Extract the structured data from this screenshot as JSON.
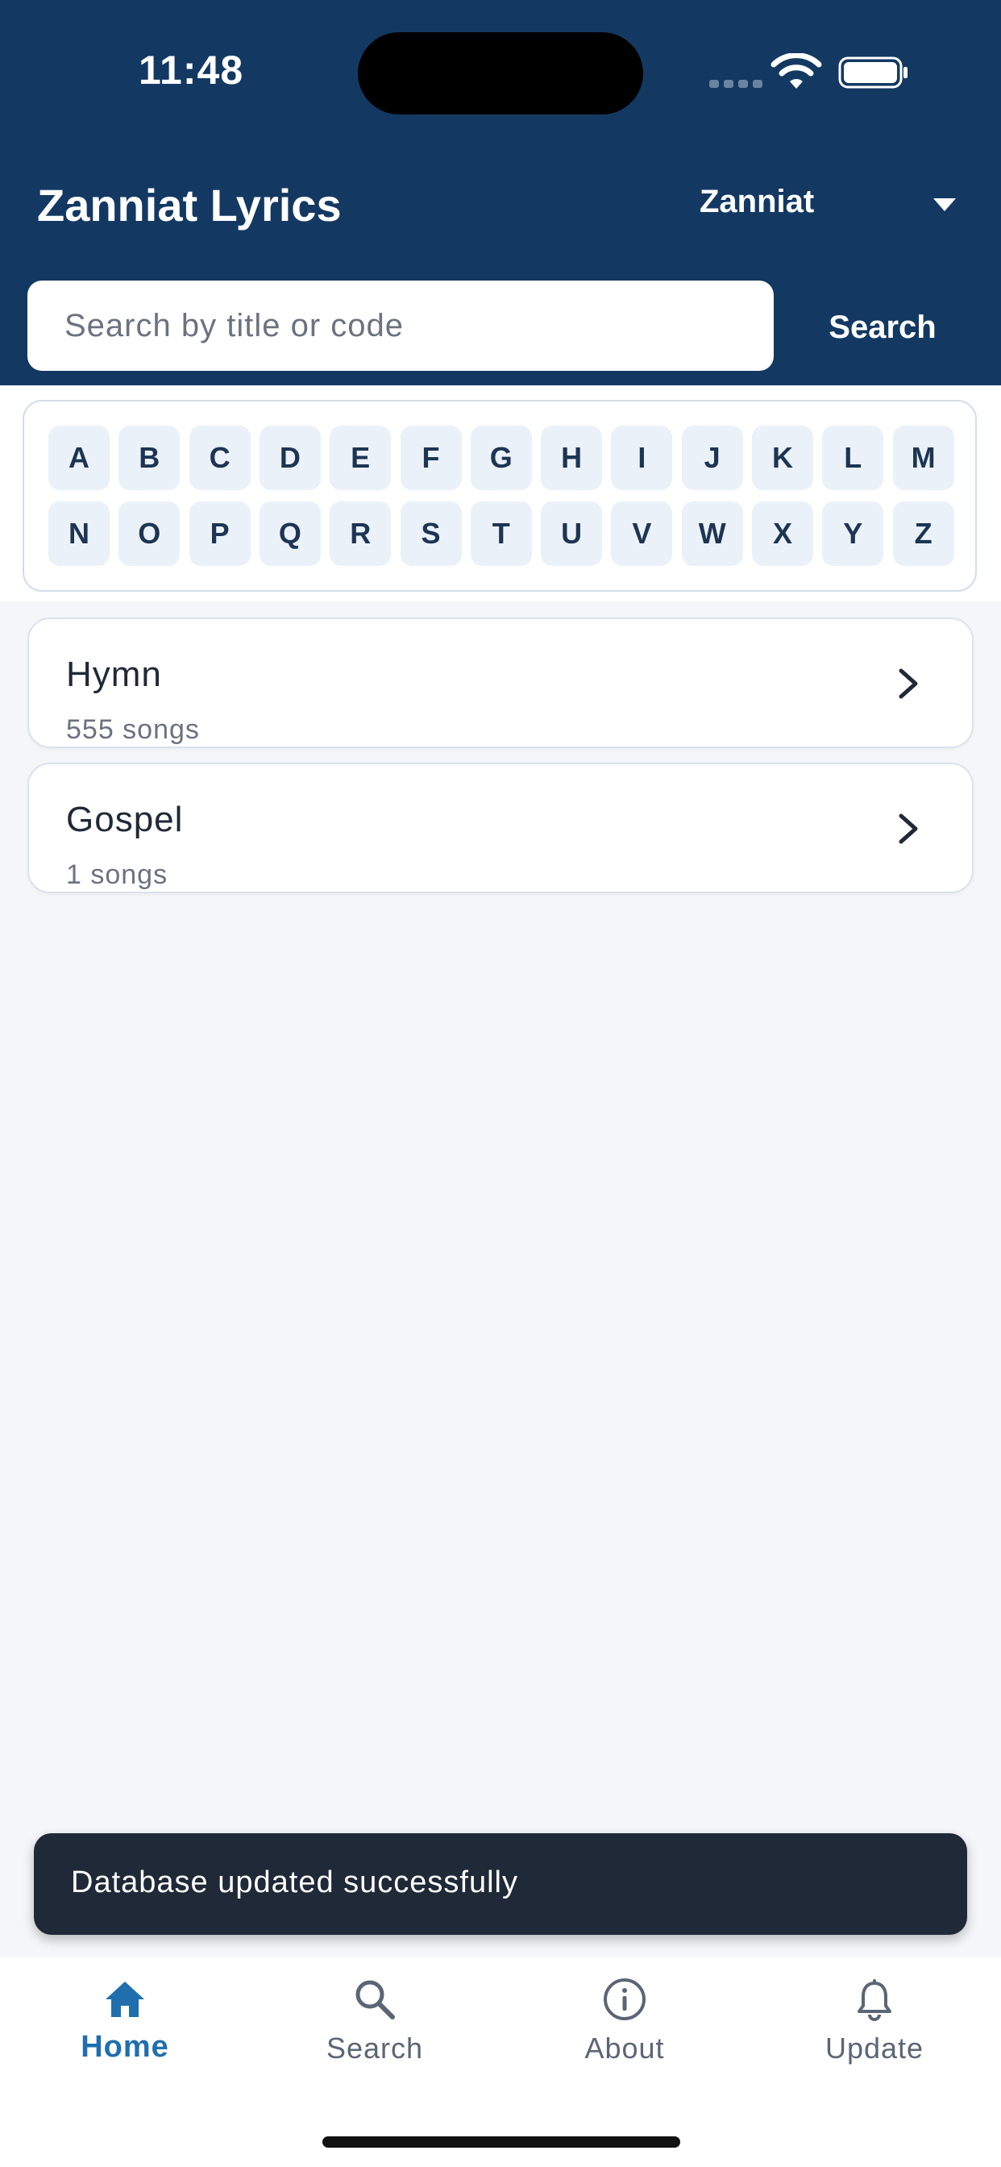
{
  "status_bar": {
    "time": "11:48"
  },
  "header": {
    "title": "Zanniat Lyrics",
    "selector_label": "Zanniat"
  },
  "search": {
    "placeholder": "Search by title or code",
    "button_label": "Search"
  },
  "alphabet": {
    "row1": [
      "A",
      "B",
      "C",
      "D",
      "E",
      "F",
      "G",
      "H",
      "I",
      "J",
      "K",
      "L",
      "M"
    ],
    "row2": [
      "N",
      "O",
      "P",
      "Q",
      "R",
      "S",
      "T",
      "U",
      "V",
      "W",
      "X",
      "Y",
      "Z"
    ]
  },
  "categories": [
    {
      "title": "Hymn",
      "subtitle": "555 songs"
    },
    {
      "title": "Gospel",
      "subtitle": "1 songs"
    }
  ],
  "toast": {
    "message": "Database updated successfully"
  },
  "nav": {
    "items": [
      {
        "label": "Home",
        "icon": "home-icon"
      },
      {
        "label": "Search",
        "icon": "search-icon"
      },
      {
        "label": "About",
        "icon": "info-icon"
      },
      {
        "label": "Update",
        "icon": "bell-icon"
      }
    ],
    "active_color": "#1f6fae"
  },
  "colors": {
    "header_bg": "#133962",
    "letter_bg": "#eaf1f8",
    "toast_bg": "#1f2937"
  }
}
